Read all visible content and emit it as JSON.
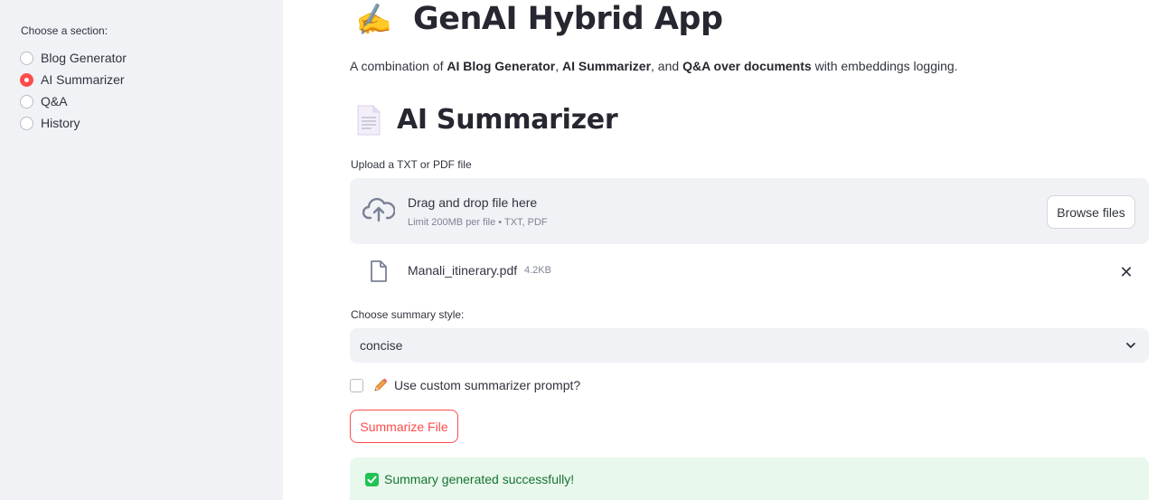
{
  "sidebar": {
    "label": "Choose a section:",
    "options": [
      {
        "label": "Blog Generator",
        "selected": false
      },
      {
        "label": "AI Summarizer",
        "selected": true
      },
      {
        "label": "Q&A",
        "selected": false
      },
      {
        "label": "History",
        "selected": false
      }
    ]
  },
  "header": {
    "emoji": "✍️",
    "title": "GenAI Hybrid App",
    "description": {
      "prefix": "A combination of ",
      "item1": "AI Blog Generator",
      "sep1": ", ",
      "item2": "AI Summarizer",
      "sep2": ", and ",
      "item3": "Q&A over documents",
      "suffix": " with embeddings logging."
    }
  },
  "section": {
    "icon": "page-icon",
    "title": "AI Summarizer"
  },
  "uploader": {
    "label": "Upload a TXT or PDF file",
    "dropzone_title": "Drag and drop file here",
    "dropzone_hint": "Limit 200MB per file • TXT, PDF",
    "browse_label": "Browse files",
    "file": {
      "name": "Manali_itinerary.pdf",
      "size": "4.2KB"
    }
  },
  "summary_style": {
    "label": "Choose summary style:",
    "value": "concise"
  },
  "custom_prompt": {
    "label": "Use custom summarizer prompt?",
    "checked": false
  },
  "actions": {
    "summarize_label": "Summarize File"
  },
  "status": {
    "message": "Summary generated successfully!"
  },
  "colors": {
    "accent": "#ff4b4b",
    "sidebar_bg": "#f0f2f6",
    "success_bg": "#e8f8ec",
    "success_text": "#177233"
  }
}
